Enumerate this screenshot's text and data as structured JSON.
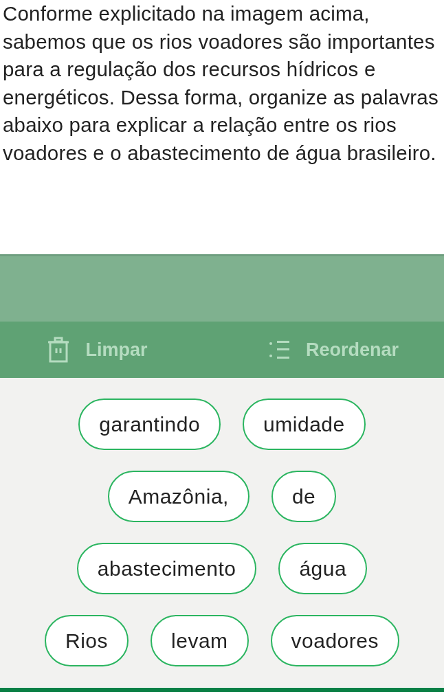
{
  "question": "Conforme explicitado na imagem acima, sabemos que os rios voadores são importantes para a regulação dos recursos hídricos e energéticos. Dessa forma, organize as palavras abaixo para explicar a relação entre os rios voadores e o abastecimento de água brasileiro.",
  "toolbar": [
    {
      "kind": "clear",
      "label": "Limpar"
    },
    {
      "kind": "reorder",
      "label": "Reordenar"
    }
  ],
  "word_rows": [
    [
      "garantindo",
      "umidade"
    ],
    [
      "Amazônia,",
      "de"
    ],
    [
      "abastecimento",
      "água"
    ],
    [
      "Rios",
      "levam",
      "voadores"
    ]
  ]
}
